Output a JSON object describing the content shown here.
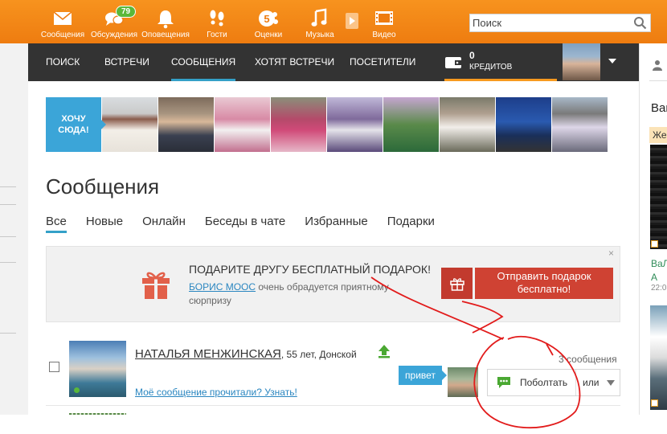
{
  "topnav": {
    "items": [
      {
        "label": "Сообщения",
        "icon": "envelope-icon"
      },
      {
        "label": "Обсуждения",
        "icon": "speech-bubbles-icon",
        "badge": "79"
      },
      {
        "label": "Оповещения",
        "icon": "bell-icon"
      },
      {
        "label": "Гости",
        "icon": "footprints-icon"
      },
      {
        "label": "Оценки",
        "icon": "rating-5-icon"
      },
      {
        "label": "Музыка",
        "icon": "music-note-icon"
      },
      {
        "label": "Видео",
        "icon": "film-icon"
      }
    ],
    "search_placeholder": "Поиск"
  },
  "subnav": {
    "tabs": [
      "ПОИСК",
      "ВСТРЕЧИ",
      "СООБЩЕНИЯ",
      "ХОТЯТ ВСТРЕЧИ",
      "ПОСЕТИТЕЛИ"
    ],
    "active_tab": "СООБЩЕНИЯ",
    "credits_count": "0",
    "credits_label": "КРЕДИТОВ"
  },
  "strip": {
    "want_label_1": "ХОЧУ",
    "want_label_2": "СЮДА!"
  },
  "page": {
    "title": "Сообщения",
    "tabs": [
      "Все",
      "Новые",
      "Онлайн",
      "Беседы в чате",
      "Избранные",
      "Подарки"
    ],
    "active_tab": "Все"
  },
  "promo": {
    "title": "ПОДАРИТЕ ДРУГУ БЕСПЛАТНЫЙ ПОДАРОК!",
    "friend_name": "БОРИС МООС",
    "text_rest": " очень обрадуется приятному сюрпризу",
    "button_line1": "Отправить подарок",
    "button_line2": "бесплатно!",
    "close": "×"
  },
  "message": {
    "name": "НАТАЛЬЯ МЕНЖИНСКАЯ",
    "meta": ", 55 лет, Донской",
    "read_link": "Моё сообщение прочитали? Узнать!",
    "count": "3 сообщения",
    "greeting": "привет",
    "chat_button": "Поболтать",
    "more_label": "или"
  },
  "rightcol": {
    "heading": "Ваш",
    "tag": "Же",
    "user_line1": "ВаЛ",
    "user_line2": "А",
    "time": "22:0"
  },
  "colors": {
    "orange": "#f7931e",
    "dark_nav": "#333333",
    "accent_blue": "#34a0c8",
    "gift_red": "#cf4233",
    "online_green": "#5ab83a",
    "annotation_red": "#e21b1b"
  }
}
